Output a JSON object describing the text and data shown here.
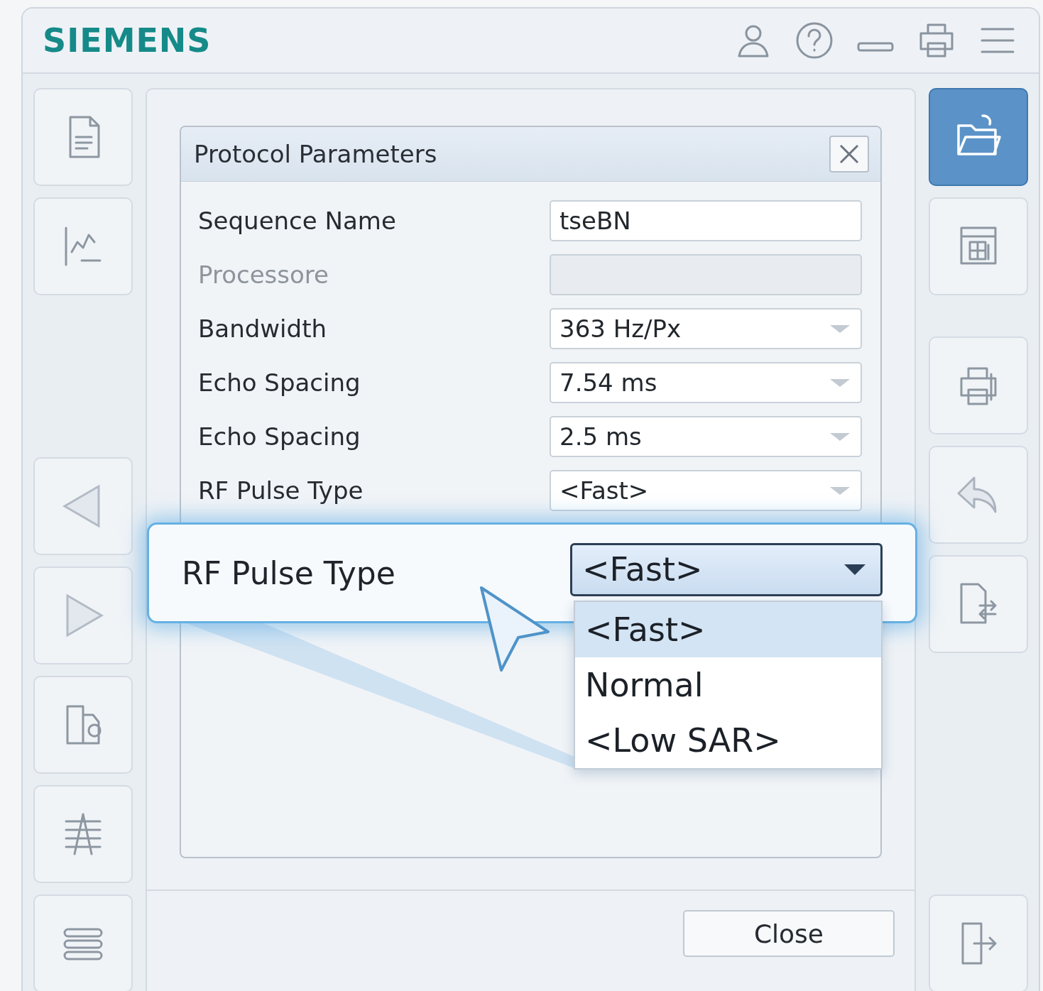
{
  "header": {
    "logo": "SIEMENS"
  },
  "left_toolbar": {
    "groups": [
      [
        {
          "selected": false
        },
        {
          "selected": false
        }
      ],
      [
        {
          "selected": false
        },
        {
          "selected": false
        },
        {
          "selected": false
        },
        {
          "selected": false
        },
        {
          "selected": false
        }
      ]
    ]
  },
  "right_toolbar": {
    "groups": [
      [
        {
          "selected": true
        },
        {
          "selected": false
        }
      ],
      [
        {
          "selected": false
        },
        {
          "selected": false
        },
        {
          "selected": false
        }
      ],
      [
        {
          "selected": false
        }
      ]
    ]
  },
  "dialog": {
    "title": "Protocol Parameters",
    "fields": [
      {
        "label": "Sequence Name",
        "kind": "text",
        "value": "tseBN",
        "disabled": false
      },
      {
        "label": "Processore",
        "kind": "text",
        "disabled": true
      },
      {
        "label": "Bandwidth",
        "kind": "select",
        "value": "363 Hz/Px",
        "disabled": false
      },
      {
        "label": "Echo Spacing",
        "kind": "select",
        "value": "7.54 ms",
        "disabled": false
      },
      {
        "label": "Echo Spacing",
        "kind": "select",
        "value": "2.5 ms",
        "disabled": false
      },
      {
        "label": "RF Pulse Type",
        "kind": "select",
        "value": "<Fast>",
        "disabled": false
      }
    ]
  },
  "callout": {
    "label": "RF Pulse Type",
    "value": "<Fast>",
    "options": [
      {
        "label": "<Fast>",
        "selected": true
      },
      {
        "label": "Normal",
        "selected": false
      },
      {
        "label": "<Low SAR>",
        "selected": false
      }
    ]
  },
  "footer": {
    "close_button": "Close"
  }
}
